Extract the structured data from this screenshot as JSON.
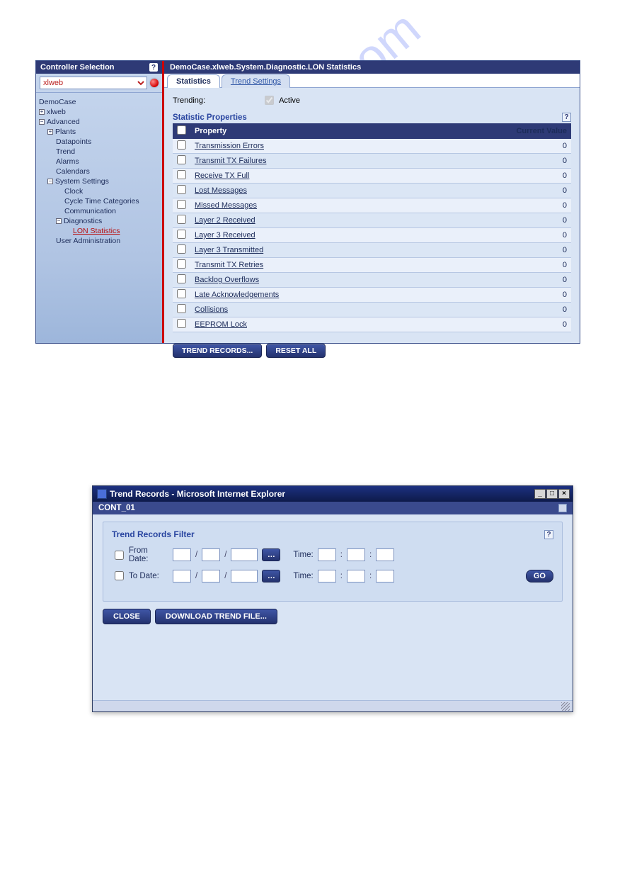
{
  "watermark_text": "manualshive.com",
  "app1": {
    "sidebar": {
      "header": "Controller Selection",
      "controller_value": "xlweb",
      "tree": {
        "root": "DemoCase",
        "n1": "xlweb",
        "n2": "Advanced",
        "plants": "Plants",
        "datapoints": "Datapoints",
        "trend": "Trend",
        "alarms": "Alarms",
        "calendars": "Calendars",
        "sys": "System Settings",
        "clock": "Clock",
        "cycle": "Cycle Time Categories",
        "comm": "Communication",
        "diag": "Diagnostics",
        "lon": "LON Statistics",
        "useradmin": "User Administration"
      }
    },
    "main": {
      "breadcrumb": "DemoCase.xlweb.System.Diagnostic.LON Statistics",
      "tabs": {
        "stats": "Statistics",
        "trend": "Trend Settings"
      },
      "trending_label": "Trending:",
      "active_label": "Active",
      "panel_title": "Statistic Properties",
      "headers": {
        "property": "Property",
        "value": "Current Value"
      },
      "rows": [
        {
          "prop": "Transmission Errors",
          "val": "0"
        },
        {
          "prop": "Transmit TX Failures",
          "val": "0"
        },
        {
          "prop": "Receive TX Full",
          "val": "0"
        },
        {
          "prop": "Lost Messages",
          "val": "0"
        },
        {
          "prop": "Missed Messages",
          "val": "0"
        },
        {
          "prop": "Layer 2 Received",
          "val": "0"
        },
        {
          "prop": "Layer 3 Received",
          "val": "0"
        },
        {
          "prop": "Layer 3 Transmitted",
          "val": "0"
        },
        {
          "prop": "Transmit TX Retries",
          "val": "0"
        },
        {
          "prop": "Backlog Overflows",
          "val": "0"
        },
        {
          "prop": "Late Acknowledgements",
          "val": "0"
        },
        {
          "prop": "Collisions",
          "val": "0"
        },
        {
          "prop": "EEPROM Lock",
          "val": "0"
        }
      ],
      "buttons": {
        "trend_records": "TREND RECORDS...",
        "reset_all": "RESET ALL"
      }
    }
  },
  "dlg": {
    "title": "Trend Records - Microsoft Internet Explorer",
    "sub": "CONT_01",
    "filter_title": "Trend Records Filter",
    "from_date": "From Date:",
    "to_date": "To Date:",
    "time_label": "Time:",
    "go": "GO",
    "close": "CLOSE",
    "download": "DOWNLOAD TREND FILE..."
  }
}
